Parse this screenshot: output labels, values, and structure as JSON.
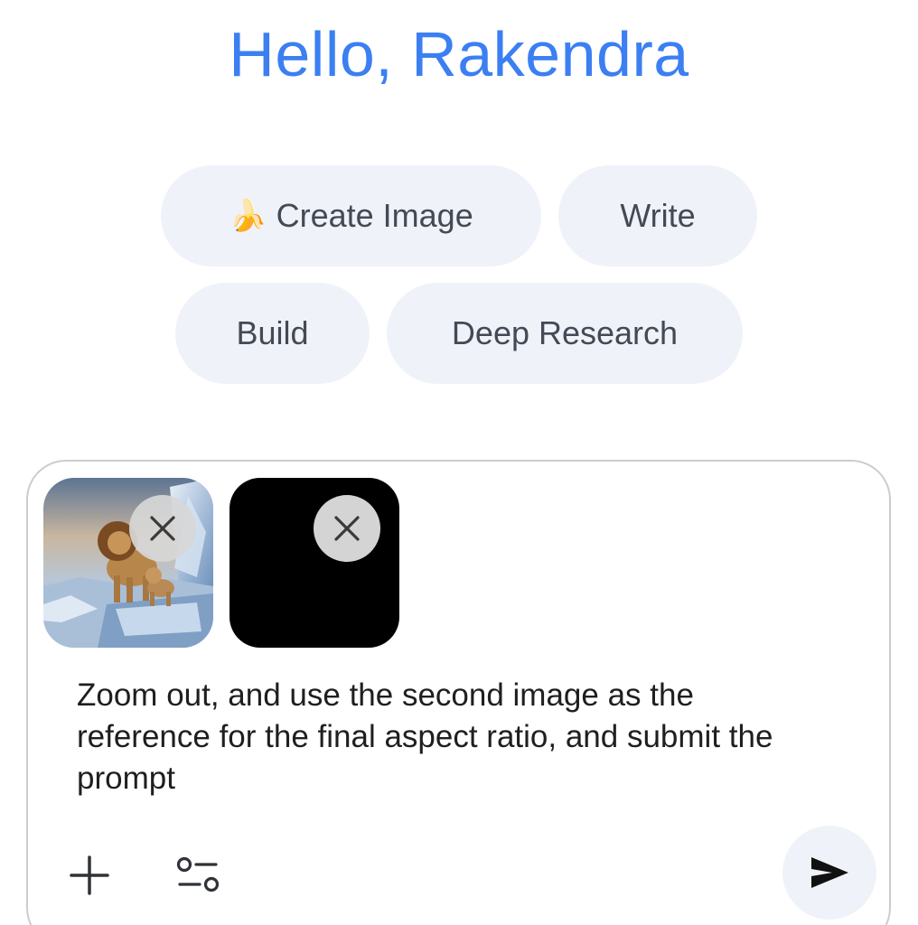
{
  "greeting": "Hello, Rakendra",
  "chips": {
    "create_image": {
      "icon": "banana-icon",
      "emoji": "🍌",
      "label": "Create Image"
    },
    "write": {
      "label": "Write"
    },
    "build": {
      "label": "Build"
    },
    "deep_research": {
      "label": "Deep Research"
    }
  },
  "composer": {
    "attachments": [
      {
        "kind": "image",
        "subject": "lion-and-cub-on-icy-cliff-thumbnail",
        "remove_icon": "close-icon"
      },
      {
        "kind": "image",
        "subject": "black-image-thumbnail",
        "remove_icon": "close-icon"
      }
    ],
    "prompt_text": "Zoom out, and use the second image as the reference for the final aspect ratio, and submit the prompt",
    "toolbar": {
      "add_icon": "plus-icon",
      "tools_icon": "tune-icon",
      "send_icon": "send-icon"
    }
  },
  "colors": {
    "greeting": "#3b7ff2",
    "chip_bg": "#eff3f9",
    "chip_text": "#444a55",
    "composer_border": "#c9cdd2"
  }
}
